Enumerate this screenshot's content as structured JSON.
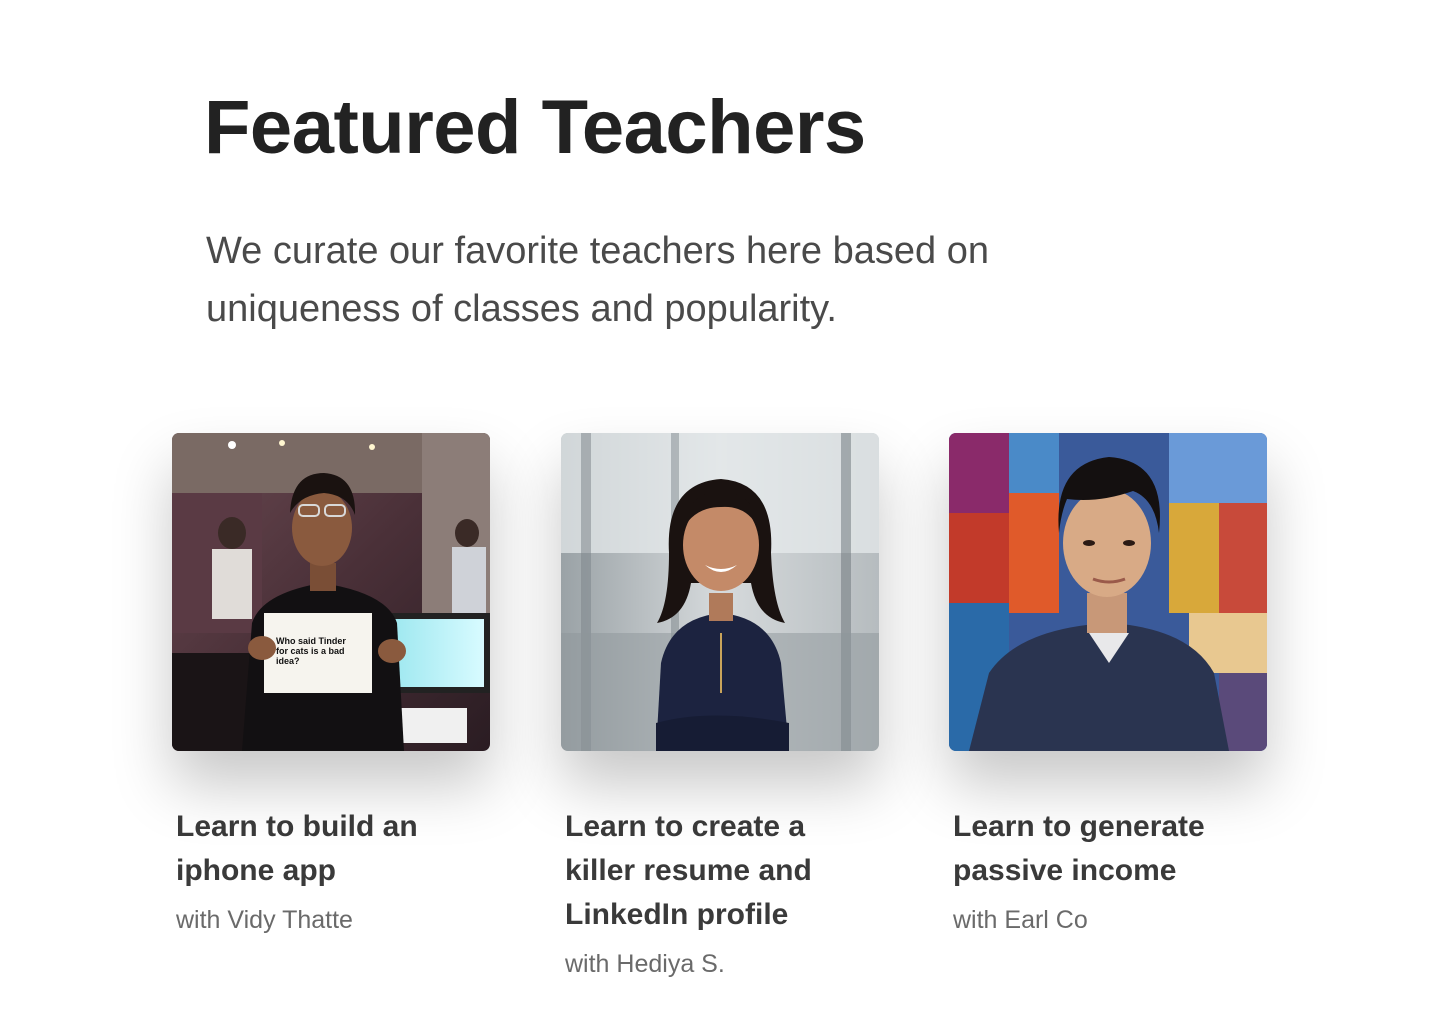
{
  "header": {
    "title": "Featured Teachers",
    "subtitle_line1": "We curate our favorite teachers here based on",
    "subtitle_line2": "uniqueness of classes and popularity."
  },
  "teachers": [
    {
      "title_line1": "Learn to build an",
      "title_line2": "iphone app",
      "title_line3": "",
      "teacher": "with Vidy Thatte",
      "photo_sign": [
        "Who said Tinder",
        "for cats is a bad",
        "idea?"
      ],
      "icon": "teacher-photo"
    },
    {
      "title_line1": "Learn to create a",
      "title_line2": "killer resume and",
      "title_line3": "LinkedIn profile",
      "teacher": "with Hediya S.",
      "icon": "teacher-photo"
    },
    {
      "title_line1": "Learn to generate",
      "title_line2": "passive income",
      "title_line3": "",
      "teacher": "with Earl Co",
      "icon": "teacher-photo"
    }
  ],
  "colors": {
    "heading": "#222222",
    "body": "#4a4a4a",
    "card_title": "#3a3a3a",
    "teacher_name": "#6a6a6a"
  }
}
